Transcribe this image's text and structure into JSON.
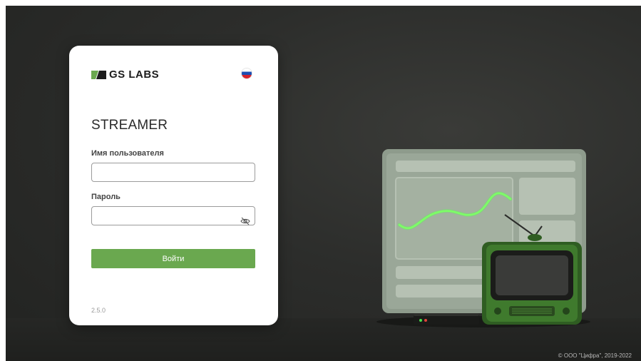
{
  "brand": {
    "name": "GS LABS",
    "accent_color": "#6aa84f"
  },
  "language": {
    "flag": "russia-flag-icon"
  },
  "app_title": "STREAMER",
  "form": {
    "username_label": "Имя пользователя",
    "username_value": "",
    "password_label": "Пароль",
    "password_value": "",
    "password_toggle_icon": "eye-off-icon",
    "submit_label": "Войти"
  },
  "version": "2.5.0",
  "footer": {
    "copyright": "© ООО \"Цифра\", 2019-2022"
  }
}
